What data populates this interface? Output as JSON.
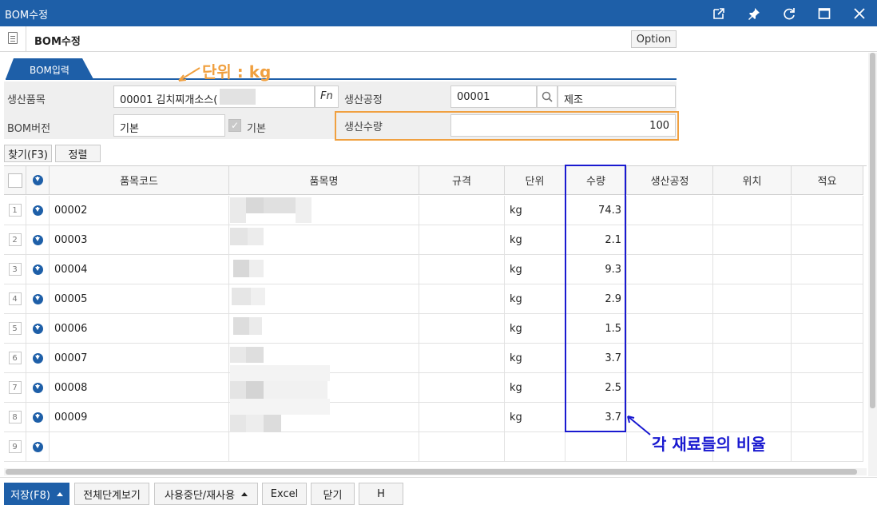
{
  "window": {
    "title": "BOM수정",
    "icons": [
      "external-link-icon",
      "pin-icon",
      "refresh-icon",
      "maximize-icon",
      "close-icon"
    ]
  },
  "header": {
    "name": "BOM수정",
    "option_label": "Option"
  },
  "tab": {
    "label": "BOM입력"
  },
  "form": {
    "product_label": "생산품목",
    "product_value": "00001 김치찌개소스(",
    "fn_label": "Fn",
    "process_label": "생산공정",
    "process_code": "00001",
    "process_name": "제조",
    "version_label": "BOM버전",
    "version_value": "기본",
    "default_label": "기본",
    "qty_label": "생산수량",
    "qty_value": "100"
  },
  "actions": {
    "find_label": "찾기(F3)",
    "sort_label": "정렬"
  },
  "grid": {
    "columns": [
      "품목코드",
      "품목명",
      "규격",
      "단위",
      "수량",
      "생산공정",
      "위치",
      "적요"
    ],
    "rows": [
      {
        "num": "1",
        "code": "00002",
        "unit": "kg",
        "qty": "74.3"
      },
      {
        "num": "2",
        "code": "00003",
        "unit": "kg",
        "qty": "2.1"
      },
      {
        "num": "3",
        "code": "00004",
        "unit": "kg",
        "qty": "9.3"
      },
      {
        "num": "4",
        "code": "00005",
        "unit": "kg",
        "qty": "2.9"
      },
      {
        "num": "5",
        "code": "00006",
        "unit": "kg",
        "qty": "1.5"
      },
      {
        "num": "6",
        "code": "00007",
        "unit": "kg",
        "qty": "3.7"
      },
      {
        "num": "7",
        "code": "00008",
        "unit": "kg",
        "qty": "2.5"
      },
      {
        "num": "8",
        "code": "00009",
        "unit": "kg",
        "qty": "3.7"
      },
      {
        "num": "9",
        "code": "",
        "unit": "",
        "qty": ""
      }
    ]
  },
  "footer": {
    "save_label": "저장(F8)",
    "view_all_label": "전체단계보기",
    "stop_reuse_label": "사용중단/재사용",
    "excel_label": "Excel",
    "close_label": "닫기",
    "h_label": "H"
  },
  "annotations": {
    "unit_note": "단위 : kg",
    "ratio_note": "각 재료들의 비율",
    "orange": "#f0a040",
    "blue": "#1a1ad0"
  },
  "colors": {
    "accent": "#1e5fa8"
  }
}
